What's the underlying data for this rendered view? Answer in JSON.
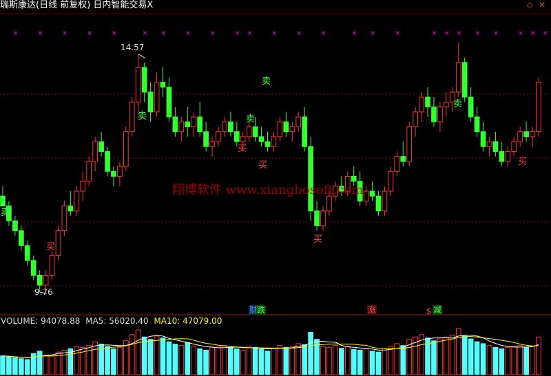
{
  "title": "瑞斯康达(日线 前复权) 日内智能交易X",
  "top_icons": {
    "diamond": "◇",
    "arrow": "✕"
  },
  "price_high_label": "14.57",
  "price_low_label": "9.76",
  "watermark": "翔博软件 www.xiangbosoft.com",
  "signals": {
    "sell": "卖",
    "buy": "买"
  },
  "event_tags": [
    {
      "text": "财",
      "color": "#4a8cff",
      "bg": "#10304a"
    },
    {
      "text": "跌",
      "color": "#40ff40",
      "bg": "#104010"
    },
    {
      "text": "涨",
      "color": "#ff4040",
      "bg": "#401010"
    },
    {
      "text": "$",
      "color": "#ff4040",
      "bg": "#000000"
    },
    {
      "text": "减",
      "color": "#40ff40",
      "bg": "#104010"
    }
  ],
  "volume": {
    "label": "VOLUME:",
    "value": "94078.88",
    "ma5_label": "MA5:",
    "ma5_value": "56020.40",
    "ma10_label": "MA10:",
    "ma10_value": "47079.00"
  },
  "colors": {
    "up": "#ff3232",
    "down": "#32ff32",
    "vol_down": "#54fcfc",
    "ma5": "#ffffff",
    "ma10": "#ffff00",
    "marker": "#ff00ff"
  },
  "chart_data": {
    "type": "candlestick",
    "price_range": [
      9.5,
      15.0
    ],
    "candles": [
      [
        11.7,
        11.9,
        11.5,
        11.5
      ],
      [
        11.5,
        11.6,
        11.1,
        11.2
      ],
      [
        11.2,
        11.3,
        10.9,
        11.0
      ],
      [
        11.0,
        11.1,
        10.6,
        10.7
      ],
      [
        10.7,
        10.8,
        10.3,
        10.4
      ],
      [
        10.4,
        10.5,
        10.0,
        10.1
      ],
      [
        10.1,
        10.2,
        9.76,
        9.9
      ],
      [
        9.9,
        10.2,
        9.8,
        10.1
      ],
      [
        10.1,
        10.6,
        10.0,
        10.5
      ],
      [
        10.5,
        11.1,
        10.4,
        11.0
      ],
      [
        11.0,
        11.6,
        10.9,
        11.5
      ],
      [
        11.5,
        11.8,
        11.3,
        11.4
      ],
      [
        11.4,
        11.9,
        11.3,
        11.8
      ],
      [
        11.8,
        12.2,
        11.6,
        12.0
      ],
      [
        12.0,
        12.5,
        11.9,
        12.4
      ],
      [
        12.4,
        12.9,
        12.2,
        12.8
      ],
      [
        12.8,
        13.0,
        12.5,
        12.6
      ],
      [
        12.6,
        12.7,
        12.1,
        12.2
      ],
      [
        12.2,
        12.3,
        11.9,
        12.1
      ],
      [
        12.1,
        12.4,
        11.9,
        12.3
      ],
      [
        12.3,
        13.1,
        12.2,
        13.0
      ],
      [
        13.0,
        13.7,
        12.9,
        13.6
      ],
      [
        13.6,
        14.57,
        13.4,
        14.3
      ],
      [
        14.3,
        14.4,
        13.6,
        13.8
      ],
      [
        13.8,
        14.0,
        13.2,
        13.4
      ],
      [
        13.4,
        14.2,
        13.3,
        14.0
      ],
      [
        14.0,
        14.3,
        13.7,
        13.9
      ],
      [
        13.9,
        14.1,
        13.2,
        13.3
      ],
      [
        13.3,
        13.5,
        12.9,
        13.0
      ],
      [
        13.0,
        13.3,
        12.8,
        13.2
      ],
      [
        13.2,
        13.5,
        12.9,
        13.1
      ],
      [
        13.1,
        13.4,
        12.9,
        13.3
      ],
      [
        13.3,
        13.6,
        12.9,
        13.0
      ],
      [
        13.0,
        13.2,
        12.6,
        12.7
      ],
      [
        12.7,
        12.9,
        12.5,
        12.8
      ],
      [
        12.8,
        13.1,
        12.7,
        13.0
      ],
      [
        13.0,
        13.3,
        12.9,
        13.2
      ],
      [
        13.2,
        13.4,
        12.9,
        13.0
      ],
      [
        13.0,
        13.2,
        12.7,
        12.8
      ],
      [
        12.8,
        13.0,
        12.6,
        12.9
      ],
      [
        12.9,
        13.2,
        12.8,
        13.1
      ],
      [
        13.1,
        13.3,
        12.8,
        12.9
      ],
      [
        12.9,
        13.1,
        12.7,
        12.8
      ],
      [
        12.8,
        13.0,
        12.6,
        12.7
      ],
      [
        12.7,
        13.0,
        12.6,
        12.9
      ],
      [
        12.9,
        13.3,
        12.8,
        13.2
      ],
      [
        13.2,
        13.4,
        12.9,
        13.0
      ],
      [
        13.0,
        13.2,
        12.8,
        13.1
      ],
      [
        13.1,
        13.4,
        13.0,
        13.3
      ],
      [
        13.3,
        13.5,
        12.6,
        12.7
      ],
      [
        12.7,
        12.9,
        11.2,
        11.4
      ],
      [
        11.4,
        11.6,
        11.0,
        11.1
      ],
      [
        11.1,
        11.5,
        11.0,
        11.4
      ],
      [
        11.4,
        11.8,
        11.3,
        11.7
      ],
      [
        11.7,
        12.0,
        11.6,
        11.9
      ],
      [
        11.9,
        12.1,
        11.7,
        11.8
      ],
      [
        11.8,
        12.2,
        11.7,
        12.1
      ],
      [
        12.1,
        12.3,
        11.9,
        12.0
      ],
      [
        12.0,
        12.2,
        11.5,
        11.6
      ],
      [
        11.6,
        11.9,
        11.5,
        11.8
      ],
      [
        11.8,
        12.0,
        11.6,
        11.7
      ],
      [
        11.7,
        11.8,
        11.3,
        11.4
      ],
      [
        11.4,
        11.9,
        11.3,
        11.8
      ],
      [
        11.8,
        12.3,
        11.7,
        12.2
      ],
      [
        12.2,
        12.6,
        12.1,
        12.5
      ],
      [
        12.5,
        12.8,
        12.3,
        12.4
      ],
      [
        12.4,
        13.2,
        12.3,
        13.1
      ],
      [
        13.1,
        13.5,
        12.9,
        13.4
      ],
      [
        13.4,
        13.8,
        13.2,
        13.7
      ],
      [
        13.7,
        13.9,
        13.3,
        13.5
      ],
      [
        13.5,
        13.7,
        13.1,
        13.2
      ],
      [
        13.2,
        13.6,
        13.0,
        13.5
      ],
      [
        13.5,
        13.8,
        13.3,
        13.6
      ],
      [
        13.6,
        13.9,
        13.4,
        13.8
      ],
      [
        13.8,
        14.8,
        13.7,
        14.4
      ],
      [
        14.4,
        14.5,
        13.6,
        13.7
      ],
      [
        13.7,
        13.9,
        13.2,
        13.3
      ],
      [
        13.3,
        13.5,
        12.9,
        13.0
      ],
      [
        13.0,
        13.2,
        12.6,
        12.7
      ],
      [
        12.7,
        12.9,
        12.5,
        12.8
      ],
      [
        12.8,
        13.0,
        12.5,
        12.6
      ],
      [
        12.6,
        12.8,
        12.3,
        12.4
      ],
      [
        12.4,
        12.7,
        12.3,
        12.6
      ],
      [
        12.6,
        12.9,
        12.5,
        12.8
      ],
      [
        12.8,
        13.1,
        12.7,
        13.0
      ],
      [
        13.0,
        13.2,
        12.8,
        12.9
      ],
      [
        12.9,
        13.1,
        12.7,
        13.0
      ],
      [
        13.0,
        14.1,
        12.9,
        14.0
      ]
    ],
    "volumes": [
      40,
      38,
      36,
      34,
      32,
      45,
      50,
      42,
      40,
      48,
      52,
      55,
      60,
      58,
      62,
      70,
      65,
      60,
      55,
      58,
      72,
      85,
      95,
      80,
      75,
      82,
      78,
      70,
      65,
      62,
      68,
      60,
      55,
      52,
      58,
      60,
      62,
      58,
      55,
      52,
      60,
      58,
      54,
      50,
      56,
      62,
      58,
      60,
      66,
      64,
      90,
      75,
      60,
      58,
      62,
      56,
      60,
      54,
      52,
      56,
      50,
      48,
      55,
      60,
      66,
      62,
      75,
      80,
      85,
      78,
      72,
      76,
      80,
      84,
      98,
      82,
      76,
      70,
      66,
      62,
      58,
      55,
      58,
      60,
      62,
      58,
      60,
      80
    ],
    "markers_x_index": [
      2,
      6,
      10,
      14,
      18,
      23,
      26,
      30,
      34,
      38,
      40,
      44,
      48,
      52,
      57,
      60,
      64,
      70,
      72,
      74,
      77,
      80,
      84,
      86,
      88
    ],
    "sell_signal_indexes": [
      0,
      28,
      49,
      75
    ],
    "buy_signal_indexes": [
      9,
      49,
      70,
      85
    ]
  }
}
